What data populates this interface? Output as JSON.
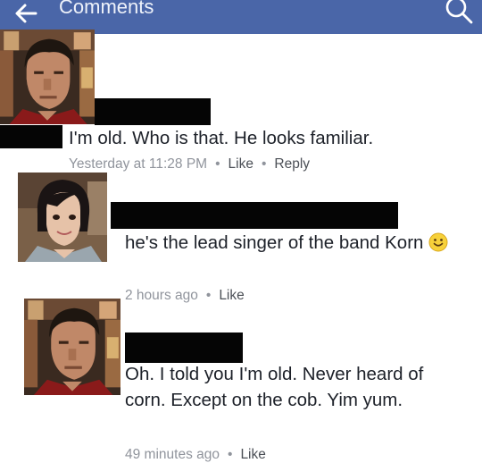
{
  "header": {
    "title": "Comments",
    "back_icon": "back-arrow-icon",
    "search_icon": "search-icon"
  },
  "colors": {
    "header_bg": "#4a66a8",
    "text": "#1d2129",
    "meta": "#90949c"
  },
  "comments": [
    {
      "author": "",
      "avatar": "avatar-man-icon",
      "text": "I'm old. Who is that. He looks familiar.",
      "time": "Yesterday at 11:28 PM",
      "like": "Like",
      "reply": "Reply"
    },
    {
      "author": "",
      "avatar": "avatar-girl-icon",
      "text": "he's the lead singer of the band Korn",
      "emoji": "smiley-icon",
      "time": "2 hours ago",
      "like": "Like"
    },
    {
      "author": "",
      "avatar": "avatar-man-icon",
      "text": "Oh. I told you I'm old. Never heard of corn. Except on the cob. Yim yum.",
      "time": "49 minutes ago",
      "like": "Like"
    }
  ]
}
